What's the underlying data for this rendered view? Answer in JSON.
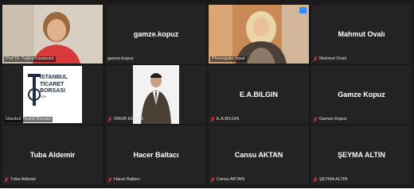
{
  "participants": [
    {
      "name": "Prof Dr. Tuğba Karabulut",
      "display": "video",
      "muted": false
    },
    {
      "name": "gamze.kopuz",
      "display": "name",
      "muted": false
    },
    {
      "name": "Phoneguler topal",
      "display": "video",
      "muted": false
    },
    {
      "name": "Mahmut Ovalı",
      "display": "name",
      "muted": true
    },
    {
      "name": "İstanbul Ticaret Borsası",
      "display": "logo",
      "muted": false
    },
    {
      "name": "ONUR ERKAN",
      "display": "video",
      "muted": true
    },
    {
      "name": "E.A.BILGIN",
      "display": "name",
      "muted": true
    },
    {
      "name": "Gamze Kopuz",
      "display": "name",
      "muted": true
    },
    {
      "name": "Tuba Aldemir",
      "display": "name",
      "muted": true
    },
    {
      "name": "Hacer Baltacı",
      "display": "name",
      "muted": true
    },
    {
      "name": "Cansu AKTAN",
      "display": "name",
      "muted": true
    },
    {
      "name": "ŞEYMA ALTIN",
      "display": "name",
      "muted": true
    }
  ],
  "logo": {
    "line1": "İSTANBUL",
    "line2": "TİCARET",
    "line3": "BORSASI",
    "year": "1926"
  },
  "more_button_label": "···",
  "colors": {
    "tile_bg": "#232323",
    "active_speaker": "#b9d44a",
    "muted_icon": "#e0303a",
    "more_button": "#2d8cff"
  }
}
